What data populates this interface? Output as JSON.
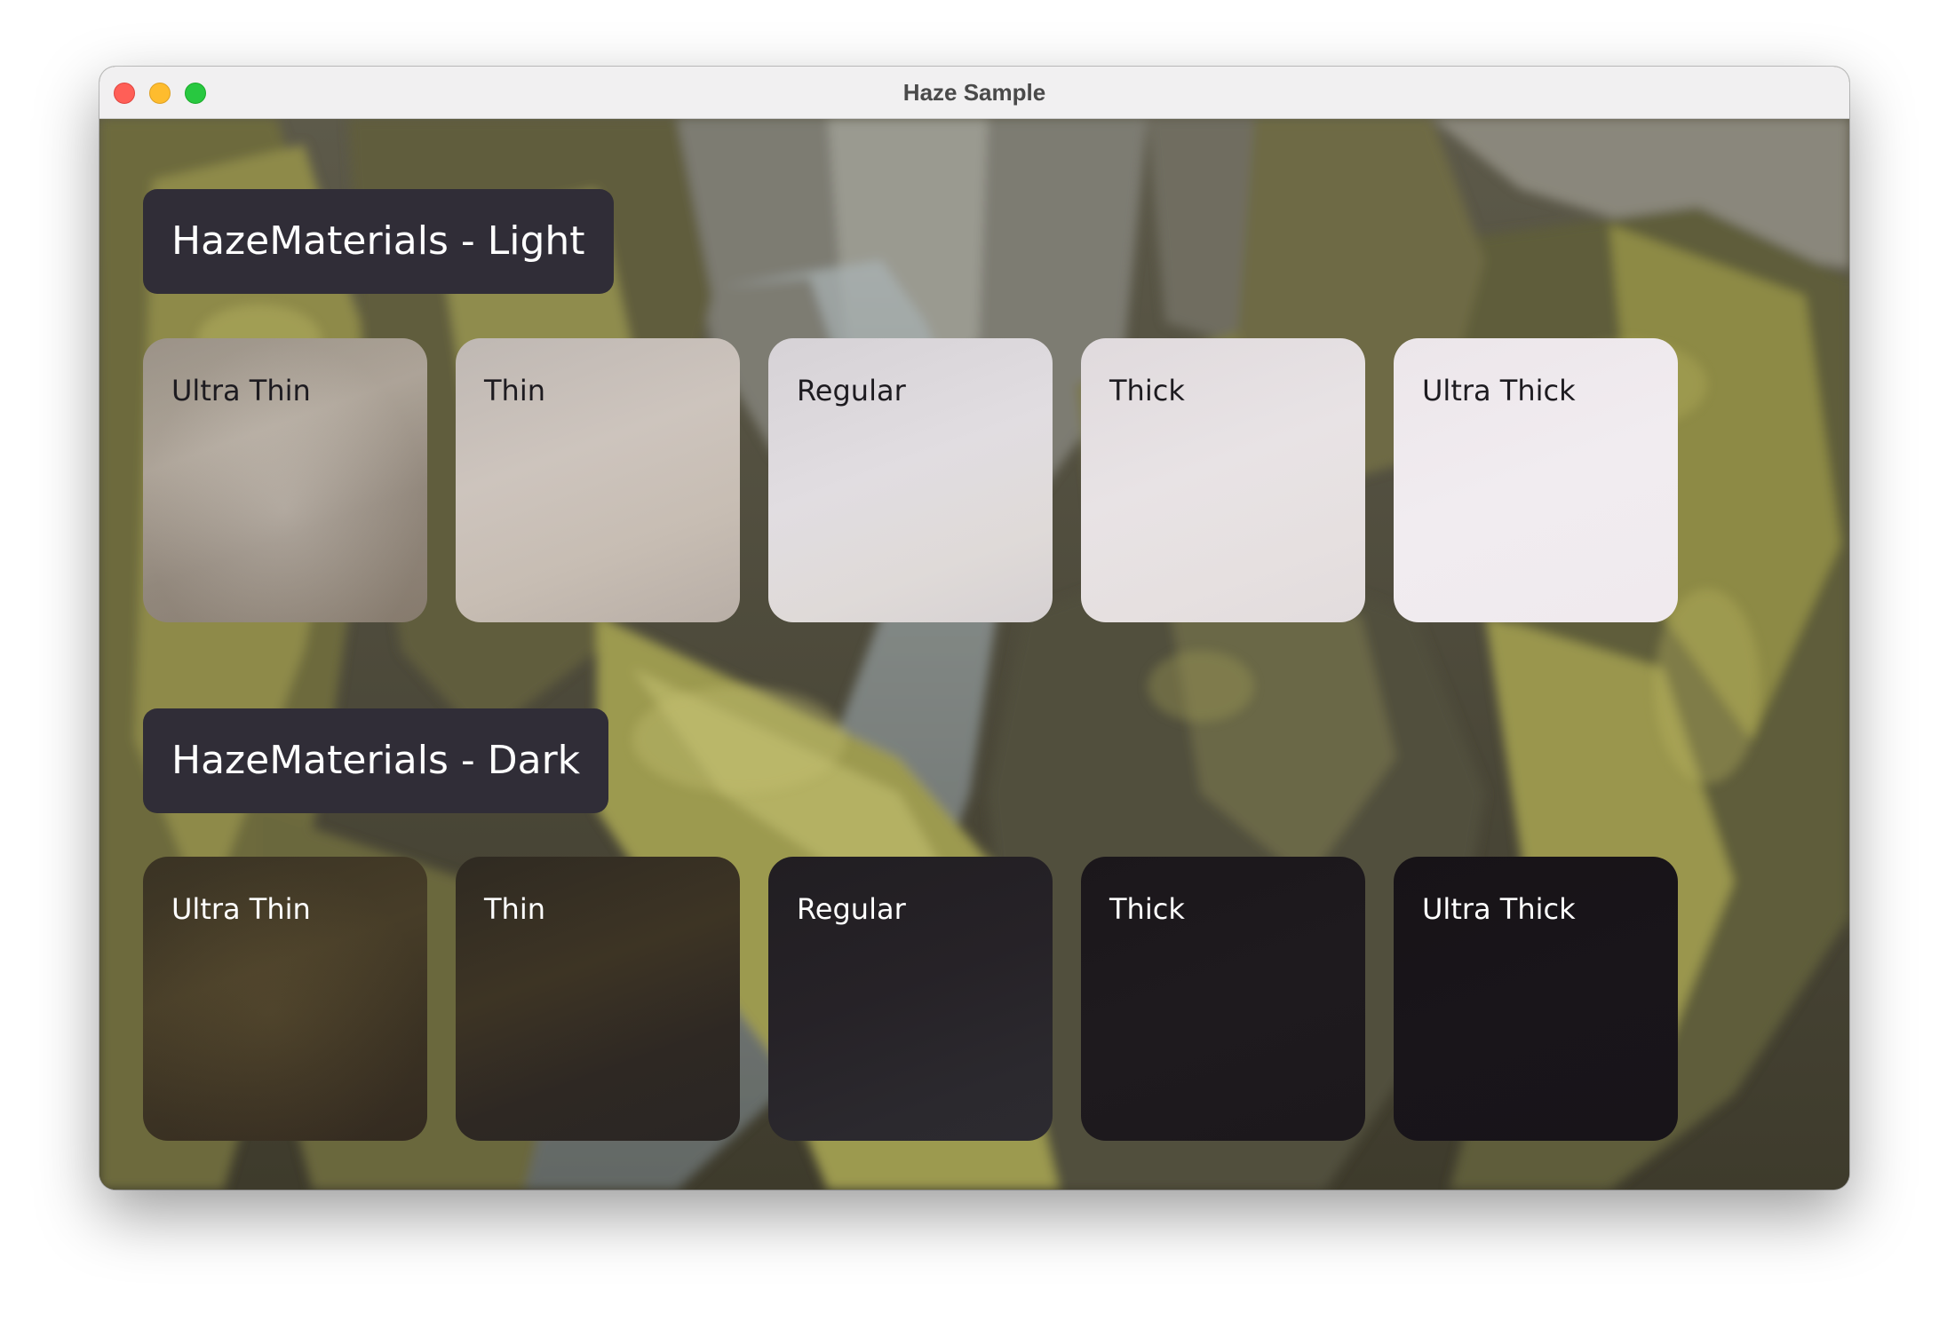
{
  "window": {
    "title": "Haze Sample"
  },
  "sections": {
    "light": {
      "header": "HazeMaterials - Light",
      "cards": [
        "Ultra Thin",
        "Thin",
        "Regular",
        "Thick",
        "Ultra Thick"
      ]
    },
    "dark": {
      "header": "HazeMaterials - Dark",
      "cards": [
        "Ultra Thin",
        "Thin",
        "Regular",
        "Thick",
        "Ultra Thick"
      ]
    }
  },
  "colors": {
    "header_background": "#302d37",
    "light_text": "#1d1b20",
    "dark_text": "#ffffff",
    "close_button": "#ff5f57",
    "minimize_button": "#febc2e",
    "zoom_button": "#28c840"
  },
  "icons": {
    "close": "close-icon",
    "minimize": "minimize-icon",
    "zoom": "zoom-icon"
  }
}
